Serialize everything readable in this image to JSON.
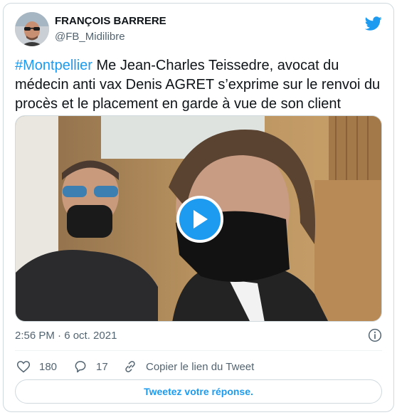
{
  "author": {
    "name": "FRANÇOIS BARRERE",
    "handle": "@FB_Midilibre"
  },
  "tweet": {
    "hashtag": "#Montpellier",
    "text": " Me Jean-Charles Teissedre, avocat du médecin anti vax Denis AGRET s’exprime sur le renvoi du procès et le placement en garde à vue de son client"
  },
  "media": {
    "type": "video",
    "play_icon": "play-icon"
  },
  "meta": {
    "timestamp": "2:56 PM · 6 oct. 2021"
  },
  "actions": {
    "likes": "180",
    "replies": "17",
    "copy_link_label": "Copier le lien du Tweet"
  },
  "reply_button_label": "Tweetez votre réponse.",
  "colors": {
    "accent": "#1d9bf0",
    "text": "#0f1419",
    "secondary": "#536471",
    "border": "#cfd9de"
  },
  "icons": [
    "twitter-bird-icon",
    "info-icon",
    "heart-icon",
    "reply-bubble-icon",
    "link-icon",
    "play-icon"
  ]
}
